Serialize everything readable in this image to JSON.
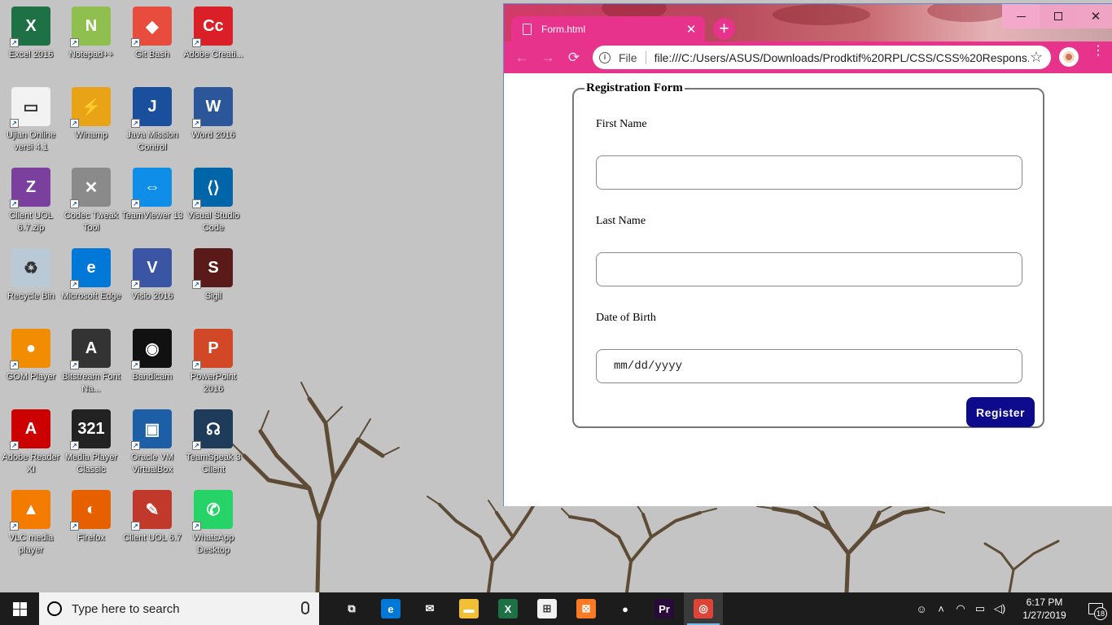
{
  "desktop": {
    "icons": [
      {
        "label": "Excel 2016",
        "glyph": "X",
        "color": "#1e7145",
        "icon": "excel-icon"
      },
      {
        "label": "Notepad++",
        "glyph": "N",
        "color": "#8fbf4e",
        "icon": "notepad-plus-plus-icon"
      },
      {
        "label": "Git Bash",
        "glyph": "◆",
        "color": "#e74c3c",
        "icon": "git-bash-icon"
      },
      {
        "label": "Adobe Creati...",
        "glyph": "Cc",
        "color": "#da1f26",
        "icon": "adobe-creative-cloud-icon"
      },
      {
        "label": "Ujian Online versi 4.1",
        "glyph": "▭",
        "color": "#f2f2f2",
        "icon": "ujian-online-icon"
      },
      {
        "label": "Winamp",
        "glyph": "⚡",
        "color": "#e8a317",
        "icon": "winamp-icon"
      },
      {
        "label": "Java Mission Control",
        "glyph": "J",
        "color": "#1a4f9e",
        "icon": "java-mission-control-icon"
      },
      {
        "label": "Word 2016",
        "glyph": "W",
        "color": "#2b579a",
        "icon": "word-icon"
      },
      {
        "label": "Client UOL 6.7.zip",
        "glyph": "Z",
        "color": "#7b3f9e",
        "icon": "winrar-archive-icon"
      },
      {
        "label": "Codec Tweak Tool",
        "glyph": "✕",
        "color": "#8a8a8a",
        "icon": "codec-tweak-tool-icon"
      },
      {
        "label": "TeamViewer 13",
        "glyph": "⇔",
        "color": "#0e8ee9",
        "icon": "teamviewer-icon"
      },
      {
        "label": "Visual Studio Code",
        "glyph": "⟨⟩",
        "color": "#0065a9",
        "icon": "vscode-icon"
      },
      {
        "label": "Recycle Bin",
        "glyph": "♻",
        "color": "#b9c9d6",
        "icon": "recycle-bin-icon"
      },
      {
        "label": "Microsoft Edge",
        "glyph": "e",
        "color": "#0078d7",
        "icon": "edge-icon"
      },
      {
        "label": "Visio 2016",
        "glyph": "V",
        "color": "#3955a3",
        "icon": "visio-icon"
      },
      {
        "label": "Sigil",
        "glyph": "S",
        "color": "#5a1a1a",
        "icon": "sigil-icon"
      },
      {
        "label": "GOM Player",
        "glyph": "●",
        "color": "#f28c00",
        "icon": "gom-player-icon"
      },
      {
        "label": "Bitstream Font Na...",
        "glyph": "A",
        "color": "#333333",
        "icon": "bitstream-font-navigator-icon"
      },
      {
        "label": "Bandicam",
        "glyph": "◉",
        "color": "#111111",
        "icon": "bandicam-icon"
      },
      {
        "label": "PowerPoint 2016",
        "glyph": "P",
        "color": "#d24726",
        "icon": "powerpoint-icon"
      },
      {
        "label": "Adobe Reader XI",
        "glyph": "A",
        "color": "#cc0000",
        "icon": "adobe-reader-icon"
      },
      {
        "label": "Media Player Classic",
        "glyph": "321",
        "color": "#222222",
        "icon": "media-player-classic-icon"
      },
      {
        "label": "Oracle VM VirtualBox",
        "glyph": "▣",
        "color": "#1d5fa7",
        "icon": "virtualbox-icon"
      },
      {
        "label": "TeamSpeak 3 Client",
        "glyph": "☊",
        "color": "#1f3b5a",
        "icon": "teamspeak-icon"
      },
      {
        "label": "VLC media player",
        "glyph": "▲",
        "color": "#f37c00",
        "icon": "vlc-icon"
      },
      {
        "label": "Firefox",
        "glyph": "◐",
        "color": "#e66000",
        "icon": "firefox-icon"
      },
      {
        "label": "Client UOL 6.7",
        "glyph": "✎",
        "color": "#c0392b",
        "icon": "client-uol-icon"
      },
      {
        "label": "WhatsApp Desktop",
        "glyph": "✆",
        "color": "#25d366",
        "icon": "whatsapp-icon"
      }
    ]
  },
  "browser": {
    "tab_title": "Form.html",
    "tab_close": "✕",
    "new_tab": "+",
    "nav": {
      "back": "←",
      "forward": "→",
      "reload": "⟳"
    },
    "omnibox": {
      "scheme_label": "File",
      "url": "file:///C:/Users/ASUS/Downloads/Prodktif%20RPL/CSS/CSS%20Respons..."
    },
    "window_controls": {
      "close": "✕"
    },
    "menu_icon": "⋮",
    "star_icon": "☆"
  },
  "form": {
    "legend": "Registration Form",
    "first_name_label": "First Name",
    "first_name_value": "",
    "last_name_label": "Last Name",
    "last_name_value": "",
    "dob_label": "Date of Birth",
    "dob_placeholder": "mm/dd/yyyy",
    "submit_label": "Register"
  },
  "taskbar": {
    "search_placeholder": "Type here to search",
    "apps": [
      {
        "icon": "task-view-icon",
        "glyph": "⧉",
        "color": "#1c1c1c"
      },
      {
        "icon": "edge-icon",
        "glyph": "e",
        "color": "#0078d7"
      },
      {
        "icon": "mail-icon",
        "glyph": "✉",
        "color": "#1c1c1c"
      },
      {
        "icon": "file-explorer-icon",
        "glyph": "▬",
        "color": "#f2c037"
      },
      {
        "icon": "excel-icon",
        "glyph": "X",
        "color": "#1e7145"
      },
      {
        "icon": "store-icon",
        "glyph": "⊞",
        "color": "#f2f2f2"
      },
      {
        "icon": "xampp-icon",
        "glyph": "⊠",
        "color": "#fb7a24"
      },
      {
        "icon": "record-icon",
        "glyph": "●",
        "color": "#1c1c1c"
      },
      {
        "icon": "premiere-icon",
        "glyph": "Pr",
        "color": "#2a0a3a"
      },
      {
        "icon": "chrome-icon",
        "glyph": "◎",
        "color": "#db4437"
      }
    ],
    "active_app": "chrome-icon",
    "clock_time": "6:17 PM",
    "clock_date": "1/27/2019",
    "notification_count": "18"
  },
  "colors": {
    "browser_accent": "#e8338c",
    "register_button": "#0d0a8c",
    "taskbar": "#1c1c1c"
  }
}
